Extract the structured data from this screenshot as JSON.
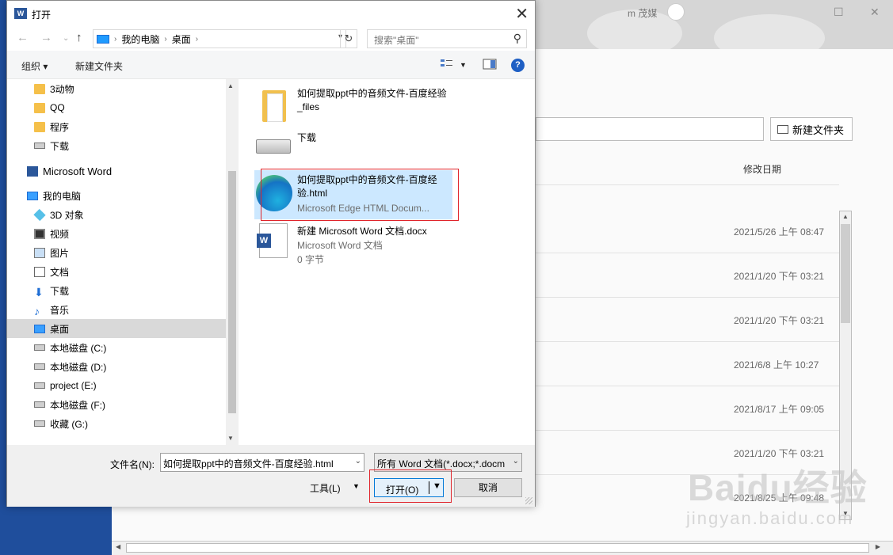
{
  "background": {
    "user_name": "m 茂媒",
    "new_folder_label": "新建文件夹",
    "column_header": "修改日期",
    "dates": [
      "2021/5/26 上午 08:47",
      "2021/1/20 下午 03:21",
      "2021/1/20 下午 03:21",
      "2021/6/8 上午 10:27",
      "2021/8/17 上午 09:05",
      "2021/1/20 下午 03:21",
      "2021/8/25 上午 09:48"
    ],
    "watermark": "Baidu经验",
    "watermark_sub": "jingyan.baidu.com"
  },
  "dialog": {
    "title": "打开",
    "word_badge": "W",
    "close_glyph": "✕",
    "breadcrumb": [
      "我的电脑",
      "桌面"
    ],
    "search_placeholder": "搜索\"桌面\"",
    "toolbar": {
      "organize": "组织 ▾",
      "new_folder": "新建文件夹",
      "help": "?"
    },
    "nav_items": [
      {
        "label": "3动物",
        "icon": "folder-icon"
      },
      {
        "label": "QQ",
        "icon": "folder-icon"
      },
      {
        "label": "程序",
        "icon": "folder-icon"
      },
      {
        "label": "下载",
        "icon": "drive-icon"
      },
      {
        "label": "Microsoft Word",
        "icon": "word-icon"
      },
      {
        "label": "我的电脑",
        "icon": "computer-icon"
      },
      {
        "label": "3D 对象",
        "icon": "3d-objects-icon"
      },
      {
        "label": "视频",
        "icon": "video-icon"
      },
      {
        "label": "图片",
        "icon": "pictures-icon"
      },
      {
        "label": "文档",
        "icon": "documents-icon"
      },
      {
        "label": "下载",
        "icon": "download-icon"
      },
      {
        "label": "音乐",
        "icon": "music-icon"
      },
      {
        "label": "桌面",
        "icon": "desktop-icon",
        "selected": true
      },
      {
        "label": "本地磁盘 (C:)",
        "icon": "drive-icon"
      },
      {
        "label": "本地磁盘 (D:)",
        "icon": "drive-icon"
      },
      {
        "label": "project (E:)",
        "icon": "drive-icon"
      },
      {
        "label": "本地磁盘 (F:)",
        "icon": "drive-icon"
      },
      {
        "label": "收藏 (G:)",
        "icon": "drive-icon"
      }
    ],
    "files": [
      {
        "name": "如何提取ppt中的音频文件-百度经验_files",
        "icon": "folder-icon"
      },
      {
        "name": "下载",
        "icon": "drive-icon"
      },
      {
        "name": "如何提取ppt中的音频文件-百度经验.html",
        "sub": "Microsoft Edge HTML Docum...",
        "icon": "edge-icon",
        "selected": true
      },
      {
        "name": "新建 Microsoft Word 文档.docx",
        "sub": "Microsoft Word 文档",
        "size": "0 字节",
        "icon": "word-doc-icon"
      }
    ],
    "filename_label": "文件名(N):",
    "filename_value": "如何提取ppt中的音频文件-百度经验.html",
    "filetype_value": "所有 Word 文档(*.docx;*.docm",
    "tools_label": "工具(L)",
    "open_label": "打开(O)",
    "cancel_label": "取消"
  },
  "colors": {
    "accent": "#0078d7",
    "highlight_box": "#e0242b",
    "selection": "#cce8ff",
    "word_blue": "#2b579a"
  }
}
